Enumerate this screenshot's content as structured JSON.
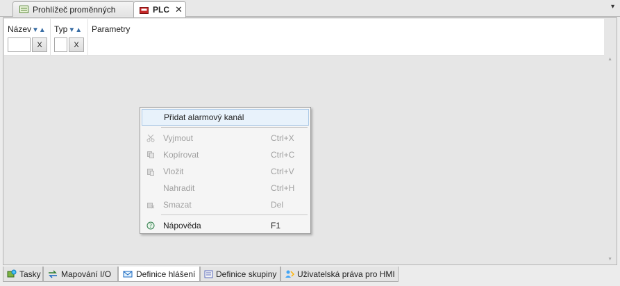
{
  "tabs": {
    "variable_viewer": "Prohlížeč proměnných",
    "plc": "PLC"
  },
  "table": {
    "columns": [
      {
        "title": "Název",
        "clear": "X",
        "filter_value": ""
      },
      {
        "title": "Typ",
        "clear": "X",
        "filter_value": ""
      },
      {
        "title": "Parametry"
      }
    ],
    "sort_glyph": "▼▲"
  },
  "context_menu": {
    "items": [
      {
        "label": "Přidat alarmový kanál",
        "shortcut": "",
        "enabled": true,
        "icon": ""
      },
      {
        "label": "Vyjmout",
        "shortcut": "Ctrl+X",
        "enabled": false,
        "icon": "scissors-icon"
      },
      {
        "label": "Kopírovat",
        "shortcut": "Ctrl+C",
        "enabled": false,
        "icon": "copy-icon"
      },
      {
        "label": "Vložit",
        "shortcut": "Ctrl+V",
        "enabled": false,
        "icon": "paste-icon"
      },
      {
        "label": "Nahradit",
        "shortcut": "Ctrl+H",
        "enabled": false,
        "icon": ""
      },
      {
        "label": "Smazat",
        "shortcut": "Del",
        "enabled": false,
        "icon": "delete-icon"
      },
      {
        "label": "Nápověda",
        "shortcut": "F1",
        "enabled": true,
        "icon": "help-icon"
      }
    ]
  },
  "bottom_tabs": [
    {
      "label": "Tasky",
      "icon": "tasks-icon"
    },
    {
      "label": "Mapování I/O",
      "icon": "mapping-icon"
    },
    {
      "label": "Definice hlášení",
      "icon": "message-icon"
    },
    {
      "label": "Definice skupiny",
      "icon": "group-icon"
    },
    {
      "label": "Uživatelská práva pro HMI",
      "icon": "user-rights-icon"
    }
  ],
  "colors": {
    "accent": "#3a6ea5",
    "menu_highlight": "#e8f2fb"
  }
}
